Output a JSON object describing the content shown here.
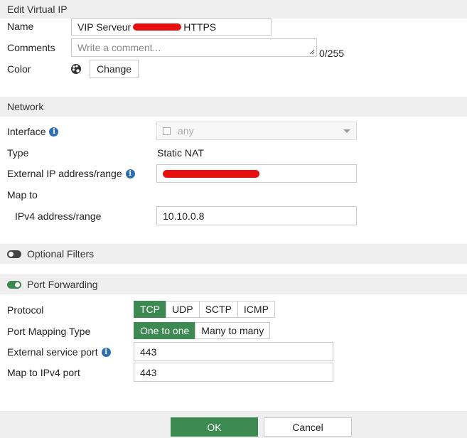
{
  "header": {
    "title": "Edit Virtual IP"
  },
  "general": {
    "name_label": "Name",
    "name_value_prefix": "VIP Serveur",
    "name_value_suffix": "HTTPS",
    "comments_label": "Comments",
    "comments_placeholder": "Write a comment...",
    "comments_counter": "0/255",
    "color_label": "Color",
    "change_button": "Change"
  },
  "network": {
    "title": "Network",
    "interface_label": "Interface",
    "interface_value": "any",
    "type_label": "Type",
    "type_value": "Static NAT",
    "external_ip_label": "External IP address/range",
    "map_to_label": "Map to",
    "ipv4_range_label": "IPv4 address/range",
    "ipv4_range_value": "10.10.0.8"
  },
  "optional_filters": {
    "label": "Optional Filters",
    "enabled": false
  },
  "port_forwarding": {
    "label": "Port Forwarding",
    "enabled": true,
    "protocol_label": "Protocol",
    "protocols": [
      "TCP",
      "UDP",
      "SCTP",
      "ICMP"
    ],
    "protocol_selected": "TCP",
    "mapping_type_label": "Port Mapping Type",
    "mapping_types": [
      "One to one",
      "Many to many"
    ],
    "mapping_selected": "One to one",
    "external_port_label": "External service port",
    "external_port_value": "443",
    "map_port_label": "Map to IPv4 port",
    "map_port_value": "443"
  },
  "footer": {
    "ok_label": "OK",
    "cancel_label": "Cancel"
  },
  "colors": {
    "accent": "#3c8a52",
    "info": "#2f6fb0",
    "redaction": "#e61010"
  }
}
